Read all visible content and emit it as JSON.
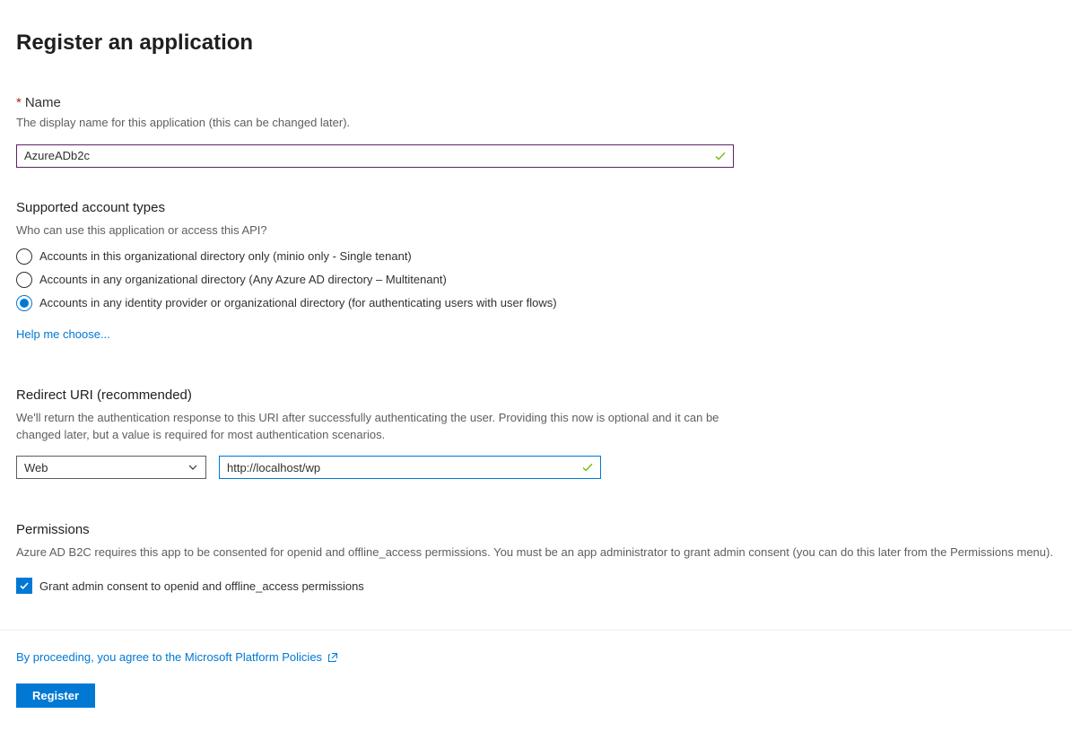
{
  "page": {
    "title": "Register an application"
  },
  "name": {
    "label": "Name",
    "desc": "The display name for this application (this can be changed later).",
    "value": "AzureADb2c"
  },
  "account_types": {
    "heading": "Supported account types",
    "desc": "Who can use this application or access this API?",
    "options": [
      "Accounts in this organizational directory only (minio only - Single tenant)",
      "Accounts in any organizational directory (Any Azure AD directory – Multitenant)",
      "Accounts in any identity provider or organizational directory (for authenticating users with user flows)"
    ],
    "selected": 2,
    "help_link": "Help me choose..."
  },
  "redirect": {
    "heading": "Redirect URI (recommended)",
    "desc": "We'll return the authentication response to this URI after successfully authenticating the user. Providing this now is optional and it can be changed later, but a value is required for most authentication scenarios.",
    "platform": "Web",
    "uri": "http://localhost/wp"
  },
  "permissions": {
    "heading": "Permissions",
    "desc": "Azure AD B2C requires this app to be consented for openid and offline_access permissions. You must be an app administrator to grant admin consent (you can do this later from the Permissions menu).",
    "checkbox_label": "Grant admin consent to openid and offline_access permissions",
    "checked": true
  },
  "footer": {
    "policy": "By proceeding, you agree to the Microsoft Platform Policies",
    "register": "Register"
  }
}
